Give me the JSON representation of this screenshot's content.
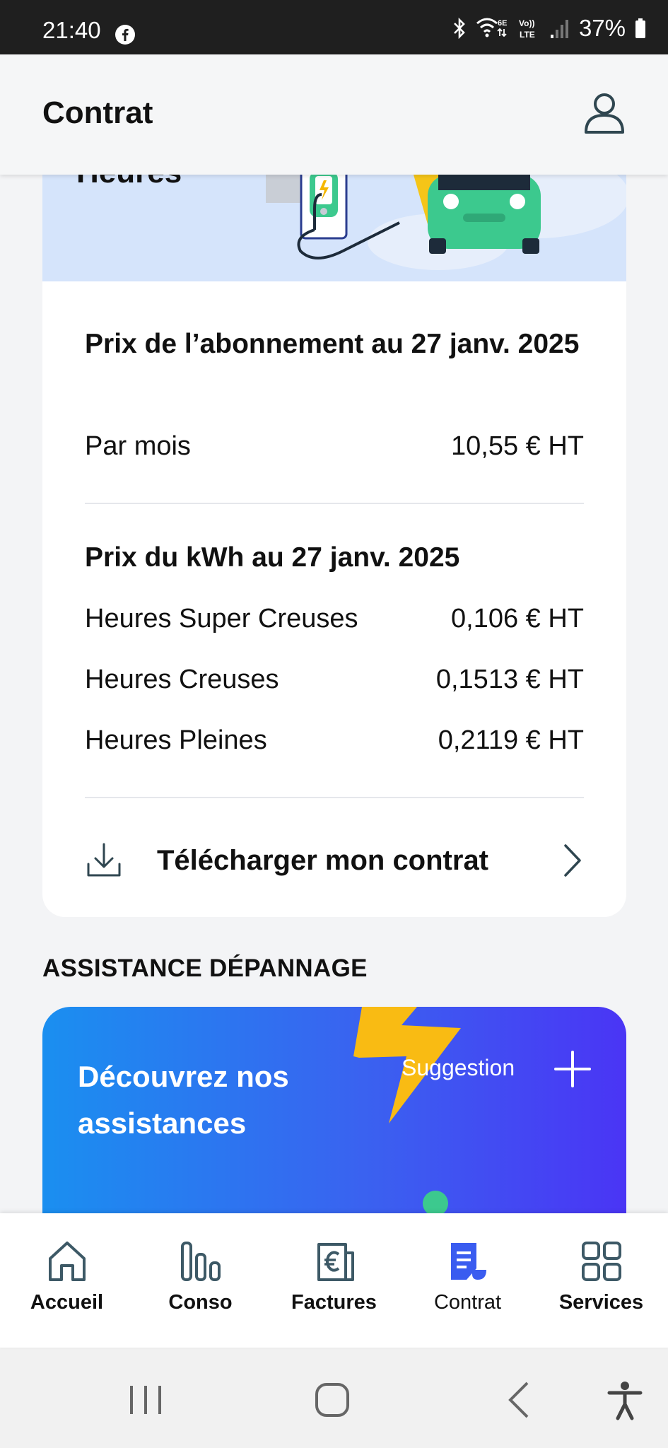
{
  "status_bar": {
    "time": "21:40",
    "battery": "37%",
    "network_label": "Vo) LTE",
    "wifi_label": "6E",
    "icons": [
      "facebook-icon",
      "bluetooth-icon",
      "wifi-icon",
      "volte-icon",
      "signal-icon",
      "battery-icon"
    ]
  },
  "header": {
    "title": "Contrat",
    "profile_icon": "user-icon"
  },
  "banner": {
    "partial_text": "Heures"
  },
  "subscription": {
    "title": "Prix de l’abonnement au 27 janv. 2025",
    "rows": [
      {
        "label": "Par mois",
        "value": "10,55 € HT"
      }
    ]
  },
  "kwh": {
    "title": "Prix du kWh au 27 janv. 2025",
    "rows": [
      {
        "label": "Heures Super Creuses",
        "value": "0,106 € HT"
      },
      {
        "label": "Heures Creuses",
        "value": "0,1513 € HT"
      },
      {
        "label": "Heures Pleines",
        "value": "0,2119 € HT"
      }
    ]
  },
  "download": {
    "label": "Télécharger mon contrat"
  },
  "assistance": {
    "section_title": "ASSISTANCE DÉPANNAGE",
    "card_text": "Découvrez nos assistances",
    "suggestion": "Suggestion"
  },
  "bottom_nav": {
    "active": "Contrat",
    "items": [
      {
        "label": "Accueil",
        "icon": "home-icon"
      },
      {
        "label": "Conso",
        "icon": "chart-bars-icon"
      },
      {
        "label": "Factures",
        "icon": "invoice-euro-icon"
      },
      {
        "label": "Contrat",
        "icon": "contract-icon"
      },
      {
        "label": "Services",
        "icon": "grid-icon"
      }
    ]
  },
  "colors": {
    "accent": "#3a5cf0",
    "nav_icon": "#3d5966",
    "banner_bg": "#d5e4fb",
    "card_gradient_start": "#1a8ff0",
    "card_gradient_end": "#4a35f5"
  }
}
